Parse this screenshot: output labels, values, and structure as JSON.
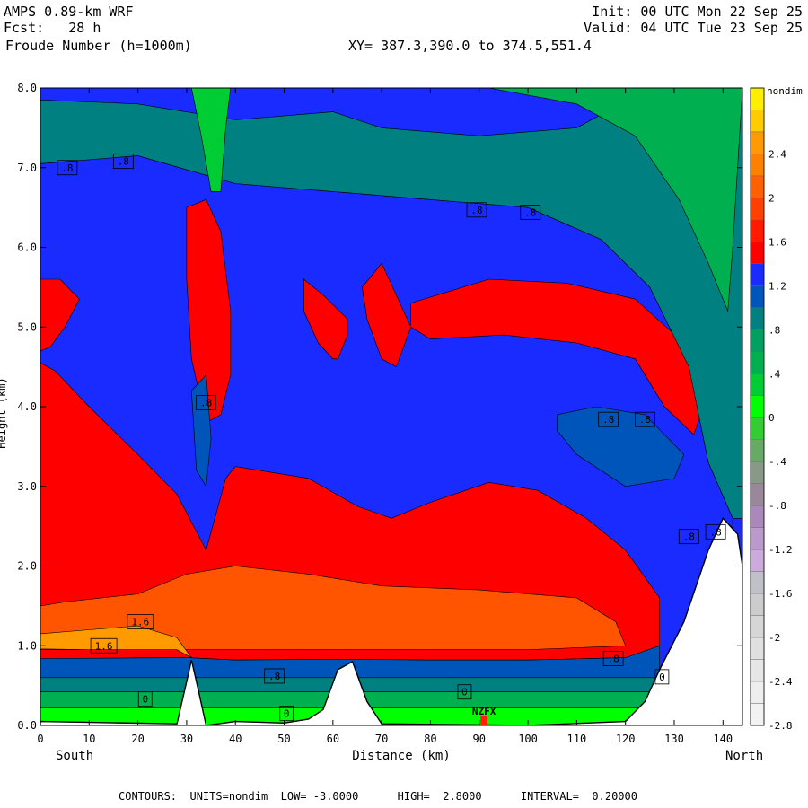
{
  "header": {
    "model": "AMPS 0.89-km WRF",
    "forecast": "Fcst:   28 h",
    "field": "Froude Number (h=1000m)",
    "init": "Init: 00 UTC Mon 22 Sep 25",
    "valid": "Valid: 04 UTC Tue 23 Sep 25",
    "xy": "XY= 387.3,390.0 to 374.5,551.4"
  },
  "footer": "CONTOURS:  UNITS=nondim  LOW= -3.0000      HIGH=  2.8000      INTERVAL=  0.20000",
  "chart_data": {
    "type": "heatmap",
    "title": "Froude Number (h=1000m)",
    "xlabel": "Distance (km)",
    "ylabel": "Height (km)",
    "x_left_label": "South",
    "x_right_label": "North",
    "xlim": [
      0,
      144
    ],
    "ylim": [
      0.0,
      8.0
    ],
    "x_ticks": [
      "0",
      "10",
      "20",
      "30",
      "40",
      "50",
      "60",
      "70",
      "80",
      "90",
      "100",
      "110",
      "120",
      "130",
      "140"
    ],
    "y_ticks": [
      "0.0",
      "1.0",
      "2.0",
      "3.0",
      "4.0",
      "5.0",
      "6.0",
      "7.0",
      "8.0"
    ],
    "units": "nondim",
    "contours": {
      "low": -3.0,
      "high": 2.8,
      "interval": 0.2
    },
    "colorbar": {
      "unit_label": "nondim",
      "labels": [
        "2.4",
        "2",
        "1.6",
        "1.2",
        ".8",
        ".4",
        "0",
        "-.4",
        "-.8",
        "-1.2",
        "-1.6",
        "-2",
        "-2.4",
        "-2.8"
      ],
      "colors": [
        "#ffee00",
        "#ffcc00",
        "#ff9a00",
        "#ff8000",
        "#ff6000",
        "#ff4000",
        "#ff1a00",
        "#ff0000",
        "#1a2bff",
        "#0055bb",
        "#008080",
        "#00a060",
        "#00b050",
        "#00cc33",
        "#00ff00",
        "#33cc33",
        "#66aa66",
        "#889988",
        "#998899",
        "#aa88bb",
        "#bb99cc",
        "#ccaadd",
        "#c0c0c8",
        "#cccccc",
        "#d6d6d6",
        "#e0e0e0",
        "#e6e6e6",
        "#eeeeee",
        "#f2f2f2"
      ]
    },
    "field_regions": [
      {
        "level": ".8",
        "color": "#1a2bff",
        "polygon": [
          [
            0,
            7.05
          ],
          [
            20,
            7.15
          ],
          [
            40,
            6.8
          ],
          [
            60,
            6.7
          ],
          [
            80,
            6.6
          ],
          [
            100,
            6.5
          ],
          [
            115,
            6.1
          ],
          [
            125,
            5.5
          ],
          [
            133,
            4.5
          ],
          [
            137,
            3.3
          ],
          [
            142,
            2.6
          ],
          [
            142,
            0
          ],
          [
            0,
            0
          ]
        ]
      },
      {
        "level": "1.2",
        "color": "#ff0000",
        "polygon": [
          [
            0,
            4.55
          ],
          [
            3,
            4.45
          ],
          [
            10,
            4.0
          ],
          [
            20,
            3.4
          ],
          [
            28,
            2.9
          ],
          [
            34,
            2.2
          ],
          [
            38,
            3.1
          ],
          [
            40,
            3.25
          ],
          [
            55,
            3.1
          ],
          [
            65,
            2.75
          ],
          [
            72,
            2.6
          ],
          [
            80,
            2.8
          ],
          [
            92,
            3.05
          ],
          [
            102,
            2.95
          ],
          [
            112,
            2.6
          ],
          [
            120,
            2.2
          ],
          [
            127,
            1.6
          ],
          [
            127,
            1.0
          ],
          [
            120,
            0.85
          ],
          [
            100,
            0.82
          ],
          [
            80,
            0.82
          ],
          [
            60,
            0.83
          ],
          [
            40,
            0.82
          ],
          [
            30,
            0.85
          ],
          [
            20,
            0.85
          ],
          [
            10,
            0.82
          ],
          [
            0,
            0.84
          ]
        ]
      },
      {
        "level": "1.2",
        "color": "#ff0000",
        "polygon": [
          [
            0,
            5.6
          ],
          [
            4,
            5.6
          ],
          [
            8,
            5.35
          ],
          [
            5,
            5.0
          ],
          [
            2,
            4.75
          ],
          [
            0,
            4.7
          ]
        ]
      },
      {
        "level": "1.2",
        "color": "#ff0000",
        "polygon": [
          [
            30,
            6.5
          ],
          [
            34,
            6.6
          ],
          [
            37,
            6.2
          ],
          [
            39,
            5.2
          ],
          [
            39,
            4.4
          ],
          [
            37,
            3.9
          ],
          [
            34,
            3.8
          ],
          [
            31,
            4.6
          ],
          [
            30,
            5.6
          ]
        ]
      },
      {
        "level": "1.2",
        "color": "#ff0000",
        "polygon": [
          [
            54,
            5.6
          ],
          [
            58,
            5.4
          ],
          [
            63,
            5.1
          ],
          [
            63,
            4.9
          ],
          [
            61,
            4.6
          ],
          [
            60,
            4.6
          ],
          [
            57,
            4.8
          ],
          [
            54,
            5.2
          ]
        ]
      },
      {
        "level": "1.2",
        "color": "#ff0000",
        "polygon": [
          [
            66,
            5.5
          ],
          [
            70,
            5.8
          ],
          [
            73,
            5.4
          ],
          [
            76,
            5.0
          ],
          [
            73,
            4.5
          ],
          [
            70,
            4.6
          ],
          [
            67,
            5.1
          ]
        ]
      },
      {
        "level": "1.2",
        "color": "#ff0000",
        "polygon": [
          [
            76,
            5.3
          ],
          [
            92,
            5.6
          ],
          [
            108,
            5.55
          ],
          [
            122,
            5.35
          ],
          [
            132,
            4.8
          ],
          [
            136,
            4.0
          ],
          [
            134,
            3.65
          ],
          [
            128,
            4.0
          ],
          [
            122,
            4.6
          ],
          [
            110,
            4.8
          ],
          [
            95,
            4.9
          ],
          [
            80,
            4.85
          ],
          [
            76,
            5.0
          ]
        ]
      },
      {
        "level": "1.6",
        "color": "#ff5500",
        "polygon": [
          [
            0,
            1.5
          ],
          [
            5,
            1.55
          ],
          [
            20,
            1.65
          ],
          [
            30,
            1.9
          ],
          [
            40,
            2.0
          ],
          [
            55,
            1.9
          ],
          [
            70,
            1.75
          ],
          [
            90,
            1.7
          ],
          [
            110,
            1.6
          ],
          [
            118,
            1.3
          ],
          [
            120,
            1.0
          ],
          [
            100,
            0.95
          ],
          [
            80,
            0.95
          ],
          [
            60,
            0.95
          ],
          [
            40,
            0.95
          ],
          [
            20,
            0.95
          ],
          [
            0,
            0.95
          ]
        ]
      },
      {
        "level": "2.0",
        "color": "#ff9a00",
        "polygon": [
          [
            0,
            1.15
          ],
          [
            10,
            1.2
          ],
          [
            20,
            1.25
          ],
          [
            28,
            1.1
          ],
          [
            31,
            0.85
          ],
          [
            28,
            0.95
          ],
          [
            20,
            0.95
          ],
          [
            10,
            0.95
          ],
          [
            0,
            0.96
          ]
        ]
      },
      {
        "level": ".6",
        "color": "#0055bb",
        "polygon": [
          [
            0,
            0.84
          ],
          [
            30,
            0.85
          ],
          [
            40,
            0.82
          ],
          [
            60,
            0.83
          ],
          [
            80,
            0.82
          ],
          [
            100,
            0.82
          ],
          [
            120,
            0.85
          ],
          [
            127,
            1.0
          ],
          [
            127,
            0.6
          ],
          [
            0,
            0.6
          ]
        ]
      },
      {
        "level": ".4",
        "color": "#008080",
        "polygon": [
          [
            0,
            0.6
          ],
          [
            127,
            0.6
          ],
          [
            126,
            0.42
          ],
          [
            0,
            0.42
          ]
        ]
      },
      {
        "level": "0",
        "color": "#00b050",
        "polygon": [
          [
            0,
            0.42
          ],
          [
            126,
            0.42
          ],
          [
            125,
            0.22
          ],
          [
            0,
            0.22
          ]
        ]
      },
      {
        "level": "-.4",
        "color": "#00ff00",
        "polygon": [
          [
            0,
            0.22
          ],
          [
            125,
            0.22
          ],
          [
            124,
            0.0
          ],
          [
            0,
            0.0
          ]
        ]
      },
      {
        "level": ".6",
        "color": "#0055bb",
        "polygon": [
          [
            106,
            3.9
          ],
          [
            114,
            4.0
          ],
          [
            124,
            3.9
          ],
          [
            132,
            3.4
          ],
          [
            130,
            3.1
          ],
          [
            120,
            3.0
          ],
          [
            110,
            3.4
          ],
          [
            106,
            3.7
          ]
        ]
      },
      {
        "level": ".6",
        "color": "#0055bb",
        "polygon": [
          [
            31,
            4.2
          ],
          [
            34,
            4.4
          ],
          [
            35,
            3.6
          ],
          [
            34,
            3.0
          ],
          [
            32,
            3.2
          ]
        ]
      },
      {
        "level": ".4",
        "color": "#008080",
        "polygon": [
          [
            0,
            7.05
          ],
          [
            20,
            7.15
          ],
          [
            40,
            6.8
          ],
          [
            60,
            6.7
          ],
          [
            80,
            6.6
          ],
          [
            100,
            6.5
          ],
          [
            115,
            6.1
          ],
          [
            125,
            5.5
          ],
          [
            133,
            4.5
          ],
          [
            137,
            3.3
          ],
          [
            142,
            2.6
          ],
          [
            144,
            2.6
          ],
          [
            144,
            8.0
          ],
          [
            125,
            8.0
          ],
          [
            110,
            7.5
          ],
          [
            90,
            7.4
          ],
          [
            70,
            7.5
          ],
          [
            60,
            7.7
          ],
          [
            40,
            7.6
          ],
          [
            20,
            7.8
          ],
          [
            0,
            7.85
          ]
        ]
      },
      {
        "level": "0",
        "color": "#00b050",
        "polygon": [
          [
            92,
            8.0
          ],
          [
            110,
            7.8
          ],
          [
            122,
            7.4
          ],
          [
            131,
            6.6
          ],
          [
            137,
            5.8
          ],
          [
            141,
            5.2
          ],
          [
            142,
            6.0
          ],
          [
            144,
            8.0
          ]
        ]
      },
      {
        "level": "-.4",
        "color": "#00cc33",
        "polygon": [
          [
            31,
            8.0
          ],
          [
            33,
            7.4
          ],
          [
            35,
            6.7
          ],
          [
            37,
            6.7
          ],
          [
            38,
            7.5
          ],
          [
            39,
            8.0
          ]
        ]
      }
    ],
    "terrain": [
      [
        0,
        0.05
      ],
      [
        28,
        0.02
      ],
      [
        30,
        0.55
      ],
      [
        31,
        0.82
      ],
      [
        32,
        0.55
      ],
      [
        34,
        0.0
      ],
      [
        40,
        0.05
      ],
      [
        50,
        0.03
      ],
      [
        55,
        0.08
      ],
      [
        58,
        0.2
      ],
      [
        61,
        0.7
      ],
      [
        64,
        0.8
      ],
      [
        67,
        0.3
      ],
      [
        70,
        0.02
      ],
      [
        100,
        0.0
      ],
      [
        120,
        0.05
      ],
      [
        124,
        0.3
      ],
      [
        127,
        0.7
      ],
      [
        132,
        1.3
      ],
      [
        137,
        2.2
      ],
      [
        140,
        2.6
      ],
      [
        143,
        2.4
      ],
      [
        144,
        2.0
      ]
    ],
    "contour_labels": [
      {
        "text": ".8",
        "x": 5.5,
        "y": 7.0
      },
      {
        "text": ".8",
        "x": 17,
        "y": 7.08
      },
      {
        "text": ".8",
        "x": 89.5,
        "y": 6.47
      },
      {
        "text": ".8",
        "x": 100.5,
        "y": 6.44
      },
      {
        "text": ".8",
        "x": 34,
        "y": 4.05
      },
      {
        "text": ".8",
        "x": 116.5,
        "y": 3.84
      },
      {
        "text": ".8",
        "x": 124,
        "y": 3.84
      },
      {
        "text": ".8",
        "x": 133,
        "y": 2.37
      },
      {
        "text": ".8",
        "x": 138.5,
        "y": 2.43
      },
      {
        "text": "1.6",
        "x": 20.5,
        "y": 1.3
      },
      {
        "text": "1.6",
        "x": 13,
        "y": 1.0
      },
      {
        "text": ".8",
        "x": 48,
        "y": 0.62
      },
      {
        "text": ".8",
        "x": 117.5,
        "y": 0.84
      },
      {
        "text": "0",
        "x": 21.5,
        "y": 0.33
      },
      {
        "text": "0",
        "x": 50.5,
        "y": 0.15
      },
      {
        "text": "0",
        "x": 87,
        "y": 0.42
      },
      {
        "text": "0",
        "x": 127.5,
        "y": 0.61
      }
    ],
    "station": {
      "label": "NZFX",
      "x": 91,
      "y": 0.1,
      "color": "#ff2200"
    }
  }
}
